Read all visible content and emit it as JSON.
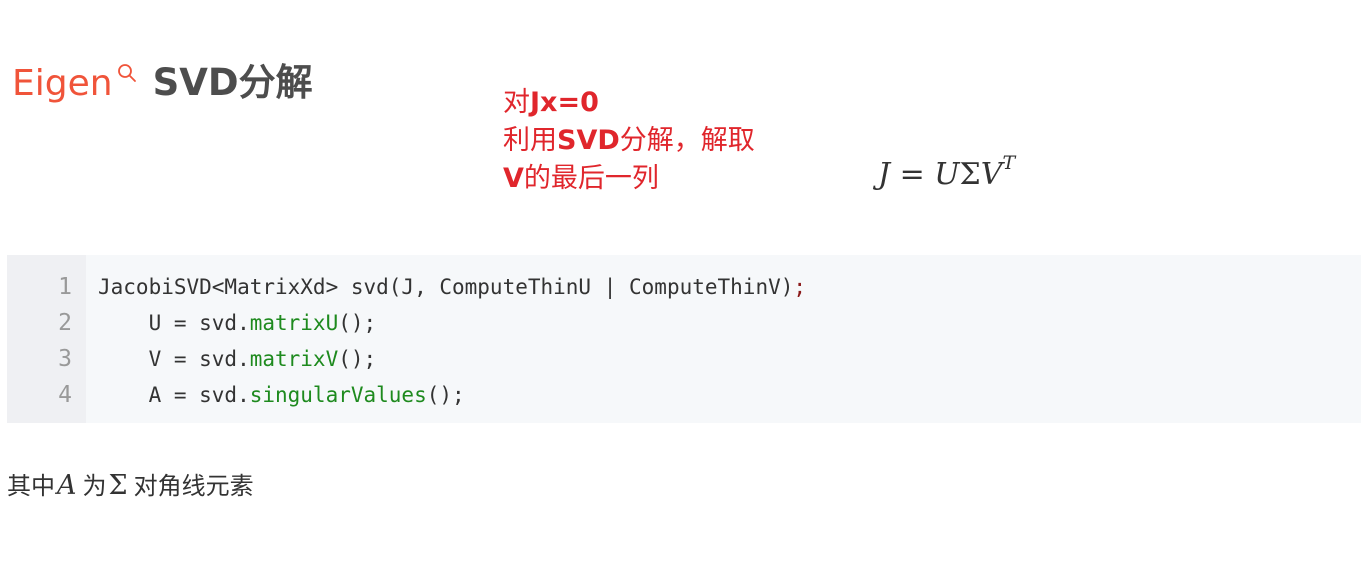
{
  "header": {
    "brand": "Eigen",
    "title": "SVD分解"
  },
  "annotation": {
    "line1_prefix": "对",
    "line1_bold": "Jx=0",
    "line2_prefix": "利用",
    "line2_bold": "SVD",
    "line2_suffix": "分解，解取",
    "line3_bold": "V",
    "line3_suffix": "的最后一列"
  },
  "formula": {
    "lhs": "J",
    "eq": " = ",
    "rhs_u": "U",
    "rhs_sigma": "Σ",
    "rhs_v": "V",
    "sup": "T"
  },
  "code": {
    "line_numbers": [
      "1",
      "2",
      "3",
      "4"
    ],
    "line1": {
      "text": "JacobiSVD<MatrixXd> svd(J, ComputeThinU | ComputeThinV)",
      "end": ";"
    },
    "line2": {
      "lead": "    U = svd.",
      "fn": "matrixU",
      "tail": "();"
    },
    "line3": {
      "lead": "    V = svd.",
      "fn": "matrixV",
      "tail": "();"
    },
    "line4": {
      "lead": "    A = svd.",
      "fn": "singularValues",
      "tail": "();"
    }
  },
  "paragraph": {
    "prefix": "其中",
    "var_a": "A",
    "middle": "为",
    "var_sigma": "Σ",
    "suffix": "对角线元素"
  },
  "colors": {
    "brand": "#f0543a",
    "annotation": "#e0262c",
    "code_function": "#1e8a1e"
  }
}
